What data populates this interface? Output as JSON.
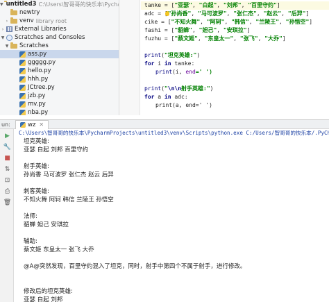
{
  "project_tree": {
    "rows": [
      {
        "label": "untitled3",
        "path": "C:\\Users\\智哥哥的快乐本\\Pycharm",
        "kind": "root-folder",
        "arrow": "▼"
      },
      {
        "label": "newtry",
        "kind": "folder",
        "arrow": ""
      },
      {
        "label": "venv",
        "suffix": "library root",
        "kind": "folder",
        "arrow": "›"
      },
      {
        "label": "External Libraries",
        "kind": "library",
        "arrow": "›"
      },
      {
        "label": "Scratches and Consoles",
        "kind": "scratch",
        "arrow": "▼"
      },
      {
        "label": "Scratches",
        "kind": "folder",
        "arrow": "▼"
      },
      {
        "label": "ass.py",
        "kind": "file",
        "selected": true
      },
      {
        "label": "ggggg.py",
        "kind": "file"
      },
      {
        "label": "hello.py",
        "kind": "file"
      },
      {
        "label": "hhh.py",
        "kind": "file"
      },
      {
        "label": "JCtree.py",
        "kind": "file"
      },
      {
        "label": "jzb.py",
        "kind": "file"
      },
      {
        "label": "mv.py",
        "kind": "file"
      },
      {
        "label": "nba.py",
        "kind": "file"
      }
    ]
  },
  "editor": {
    "lines": [
      {
        "var": "tanke",
        "op": " = [",
        "items": [
          "\"亚瑟\"",
          "\"白起\"",
          "\"刘邦\"",
          "\"百里守约\""
        ],
        "end": "]"
      },
      {
        "var": "adc",
        "op": " = [",
        "items": [
          "\"孙尚香\"",
          "\"马可波罗\"",
          "\"张仁杰\"",
          "\"赵云\"",
          "\"后羿\""
        ],
        "end": "]"
      },
      {
        "var": "cike",
        "op": " = [",
        "items": [
          "\"不知火舞\"",
          "\"阿轲\"",
          "\"韩信\"",
          "\"兰陵王\"",
          "\"孙悟空\""
        ],
        "end": "]"
      },
      {
        "var": "fashi",
        "op": " = [",
        "items": [
          "\"貂蝉\"",
          "\"妲己\"",
          "\"安琪拉\""
        ],
        "end": "]"
      },
      {
        "var": "fuzhu",
        "op": " = [",
        "items": [
          "\"蔡文姬\"",
          "\"东皇太一\"",
          "\"张飞\"",
          "\"大乔\""
        ],
        "end": "]"
      }
    ],
    "print1_fn": "print",
    "print1_arg": "\"坦克英雄:\"",
    "for1_kw": "for",
    "for1_var": " i ",
    "for1_in": "in",
    "for1_iter": " tanke:",
    "inner1_fn": "print",
    "inner1_args": "(i, ",
    "inner1_kw": "end",
    "inner1_val": "=' ')",
    "print2_fn": "print",
    "print2_esc": "\\n\\n",
    "print2_text": "射手英雄:",
    "for2_kw": "for",
    "for2_var": " a ",
    "for2_in": "in",
    "for2_iter": " adc:",
    "inner2_text": "print(a, end=' ')"
  },
  "run_panel": {
    "prefix": "un:",
    "tab_label": "wz",
    "command": "C:\\Users\\智哥哥的快乐本\\PycharmProjects\\untitled3\\venv\\Scripts\\python.exe C:/Users/智哥哥的快乐本/.PyChar",
    "output": [
      "坦克英雄:",
      "亚瑟 白起 刘邦 百里守约",
      "",
      "射手英雄:",
      "孙尚香 马可波罗 张仁杰 赵云 后羿",
      "",
      "刺客英雄:",
      "不知火舞 阿轲 韩信 兰陵王 孙悟空",
      "",
      "法师:",
      "貂蝉 妲己 安琪拉",
      "",
      "辅助:",
      "蔡文姬 东皇太一 张飞 大乔",
      "",
      "@A@突然发现，百里守约混入了坦克，同时，射手中第四个不属于射手，进行修改。",
      "",
      "",
      "修改后的坦克英雄:",
      "亚瑟 白起 刘邦"
    ]
  },
  "icons": {
    "run": "play-icon",
    "stop": "stop-icon",
    "rerun": "rerun-icon",
    "pin": "pin-icon",
    "print": "print-icon",
    "delete": "trash-icon"
  }
}
